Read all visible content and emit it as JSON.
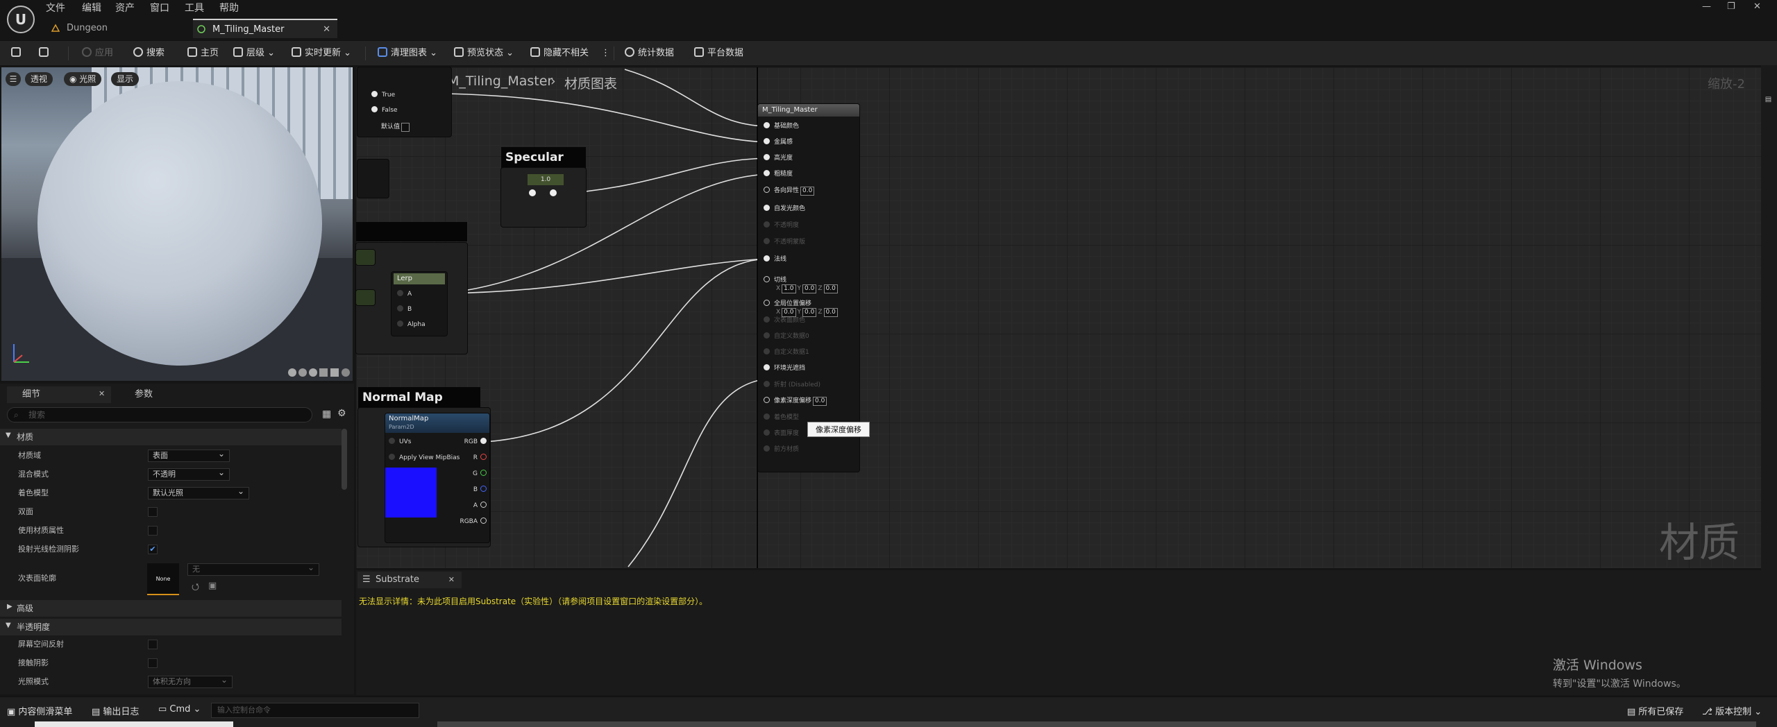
{
  "menu": [
    "文件",
    "编辑",
    "资产",
    "窗口",
    "工具",
    "帮助"
  ],
  "tabs": [
    {
      "label": "Dungeon"
    },
    {
      "label": "M_Tiling_Master"
    }
  ],
  "toolbar": {
    "apply": "应用",
    "search": "搜索",
    "home": "主页",
    "hierarchy": "层级",
    "live_update": "实时更新",
    "clean_graph": "清理图表",
    "preview_state": "预览状态",
    "hide_unrelated": "隐藏不相关",
    "stats": "统计数据",
    "platform_stats": "平台数据"
  },
  "viewport": {
    "perspective": "透视",
    "lit": "光照",
    "show": "显示"
  },
  "graph": {
    "title": "M_Tiling_Master",
    "breadcrumb": "材质图表",
    "zoom": "缩放-2",
    "watermark": "材质"
  },
  "details": {
    "tab_details": "细节",
    "tab_params": "参数",
    "search_placeholder": "搜索",
    "sections": {
      "material": "材质",
      "advanced": "高级",
      "translucency": "半透明度"
    },
    "props": [
      {
        "label": "材质域",
        "value": "表面"
      },
      {
        "label": "混合模式",
        "value": "不透明"
      },
      {
        "label": "着色模型",
        "value": "默认光照"
      },
      {
        "label": "双面"
      },
      {
        "label": "使用材质属性"
      },
      {
        "label": "投射光线检测阴影"
      },
      {
        "label": "次表面轮廓",
        "value": "无",
        "thumb": "None"
      }
    ],
    "transl_props": [
      {
        "label": "屏幕空间反射"
      },
      {
        "label": "接触阴影"
      },
      {
        "label": "光照模式",
        "value": "体积无方向"
      }
    ]
  },
  "nodes": {
    "switch_pins": {
      "true": "True",
      "false": "False",
      "default": "默认值"
    },
    "specular": "Specular",
    "specular_val": "1.0",
    "lerp": "Lerp",
    "lerp_pins": [
      "A",
      "B",
      "Alpha"
    ],
    "normalmap_comment": "Normal Map",
    "normalmap_title": "NormalMap",
    "normalmap_sub": "Param2D",
    "normalmap_inputs": [
      "UVs",
      "Apply View MipBias"
    ],
    "normalmap_outputs": [
      "RGB",
      "R",
      "G",
      "B",
      "A",
      "RGBA"
    ],
    "master_title": "M_Tiling_Master",
    "master_pins": [
      {
        "label": "基础颜色",
        "active": true
      },
      {
        "label": "金属感",
        "active": true
      },
      {
        "label": "高光度",
        "active": true
      },
      {
        "label": "粗糙度",
        "active": true
      },
      {
        "label": "各向异性",
        "active": true,
        "val": "0.0"
      },
      {
        "label": "自发光颜色",
        "active": true
      },
      {
        "label": "不透明度",
        "active": false
      },
      {
        "label": "不透明蒙版",
        "active": false
      },
      {
        "label": "法线",
        "active": true
      },
      {
        "label": "切线",
        "active": true,
        "xyz": [
          "1.0",
          "0.0",
          "0.0"
        ]
      },
      {
        "label": "全局位置偏移",
        "active": true,
        "xyz": [
          "0.0",
          "0.0",
          "0.0"
        ]
      },
      {
        "label": "次表面颜色",
        "active": false
      },
      {
        "label": "自定义数据0",
        "active": false
      },
      {
        "label": "自定义数据1",
        "active": false
      },
      {
        "label": "环境光遮挡",
        "active": true
      },
      {
        "label": "折射 (Disabled)",
        "active": false
      },
      {
        "label": "像素深度偏移",
        "active": true,
        "val": "0.0"
      },
      {
        "label": "着色模型",
        "active": false
      },
      {
        "label": "表面厚度",
        "active": false
      },
      {
        "label": "前方材质",
        "active": false
      }
    ],
    "tooltip": "像素深度偏移"
  },
  "substrate": {
    "tab": "Substrate",
    "message": "无法显示详情：未为此项目启用Substrate（实验性）（请参阅项目设置窗口的渲染设置部分）。"
  },
  "statusbar": {
    "content_drawer": "内容侧滑菜单",
    "output_log": "输出日志",
    "cmd": "Cmd",
    "console_placeholder": "输入控制台命令",
    "save_all": "所有已保存",
    "source_control": "版本控制"
  },
  "activate": {
    "title": "激活 Windows",
    "subtitle": "转到\"设置\"以激活 Windows。"
  }
}
